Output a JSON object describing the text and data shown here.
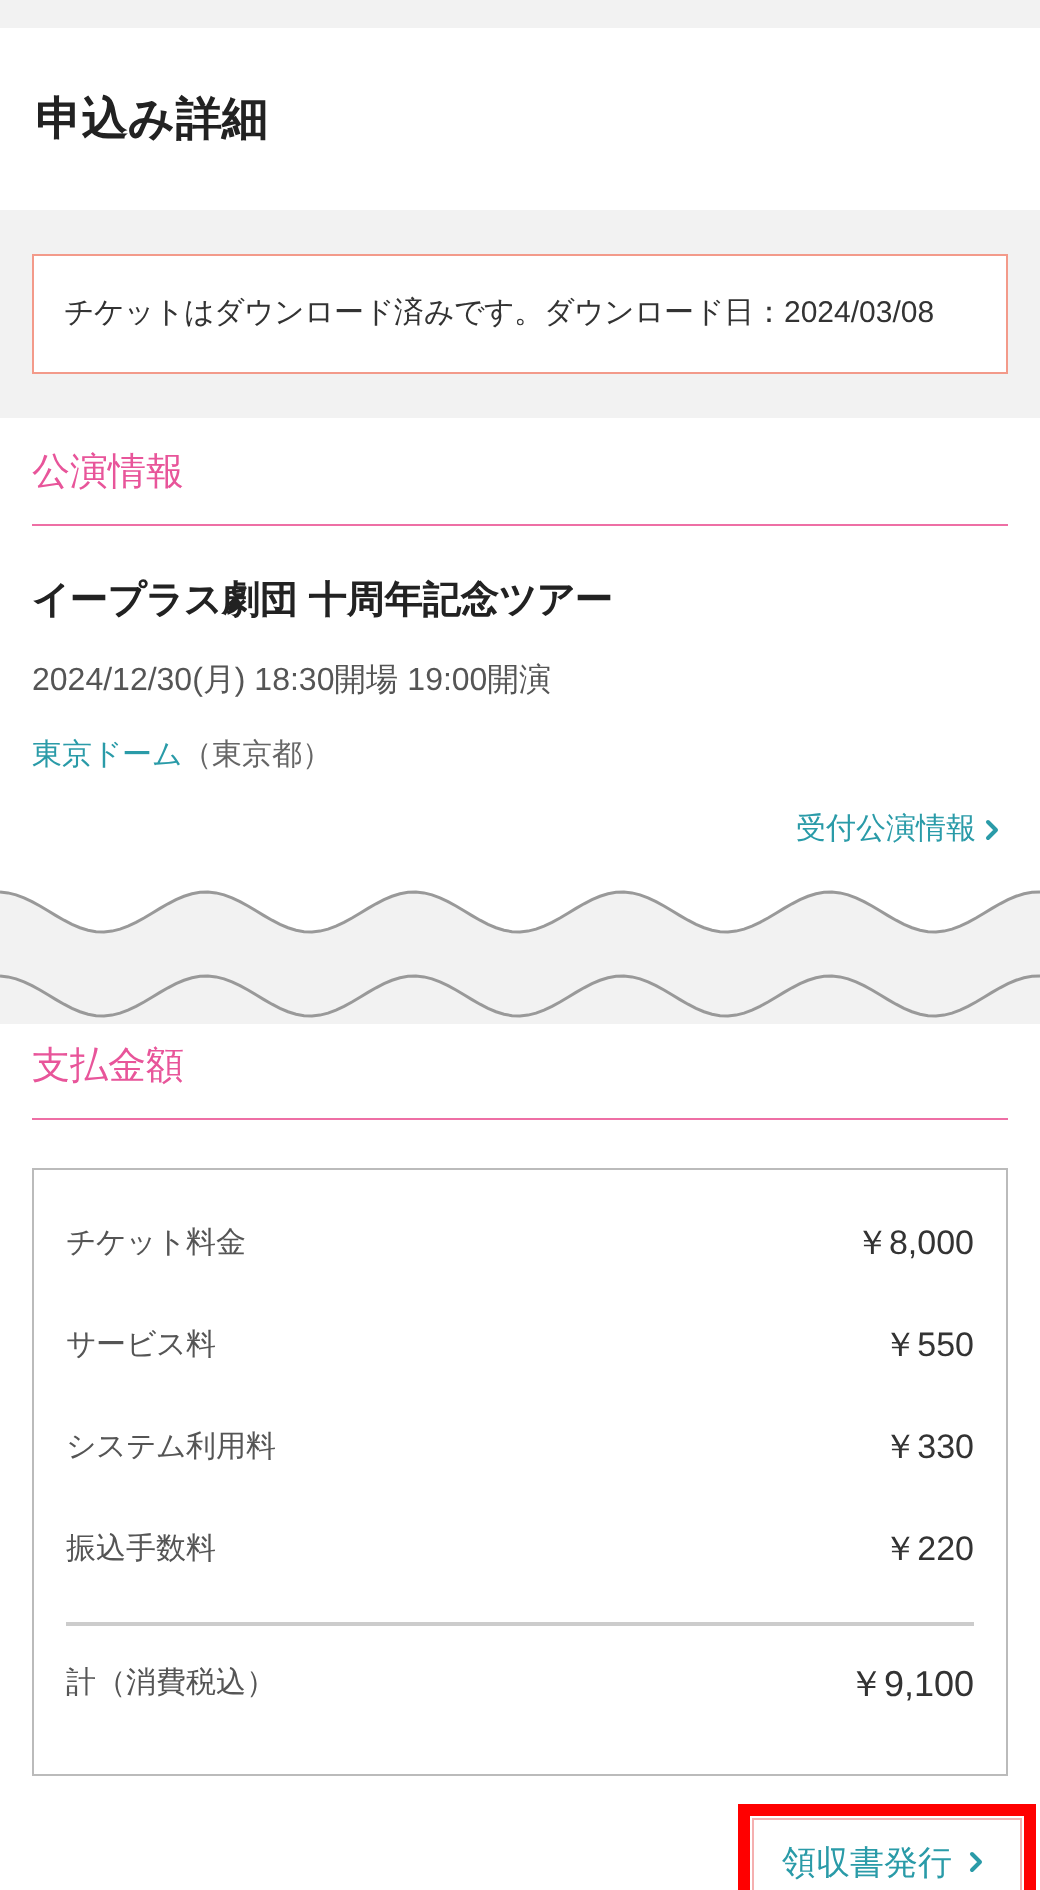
{
  "page_title": "申込み詳細",
  "notice": "チケットはダウンロード済みです。ダウンロード日：2024/03/08",
  "performance": {
    "heading": "公演情報",
    "name": "イープラス劇団 十周年記念ツアー",
    "datetime": "2024/12/30(月) 18:30開場 19:00開演",
    "venue": "東京ドーム",
    "venue_area": "（東京都）",
    "link": "受付公演情報"
  },
  "payment": {
    "heading": "支払金額",
    "items": [
      {
        "label": "チケット料金",
        "amount": "￥8,000"
      },
      {
        "label": "サービス料",
        "amount": "￥550"
      },
      {
        "label": "システム利用料",
        "amount": "￥330"
      },
      {
        "label": "振込手数料",
        "amount": "￥220"
      }
    ],
    "total": {
      "label": "計（消費税込）",
      "amount": "￥9,100"
    }
  },
  "receipt_button": "領収書発行"
}
